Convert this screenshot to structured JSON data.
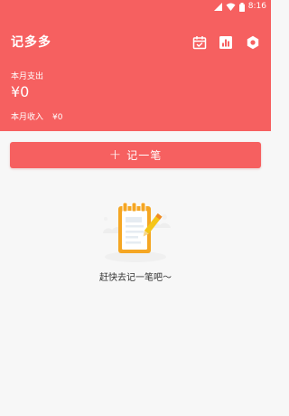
{
  "status_bar": {
    "time": "8:16",
    "icons": [
      "signal-icon",
      "wifi-icon",
      "battery-icon"
    ]
  },
  "app": {
    "title": "记多多"
  },
  "header": {
    "icons": [
      "calendar-check-icon",
      "bar-chart-icon",
      "settings-icon"
    ],
    "month_expense_label": "本月支出",
    "month_expense_value": "¥0",
    "month_income_label": "本月收入",
    "month_income_value": "¥0"
  },
  "actions": {
    "add_symbol": "+",
    "add_label": "记一笔"
  },
  "empty_state": {
    "text": "赶快去记一笔吧～",
    "icon": "notepad-pencil-icon"
  },
  "colors": {
    "primary": "#f66060",
    "background": "#f7f7f7",
    "illustration_accent": "#f5a623"
  }
}
